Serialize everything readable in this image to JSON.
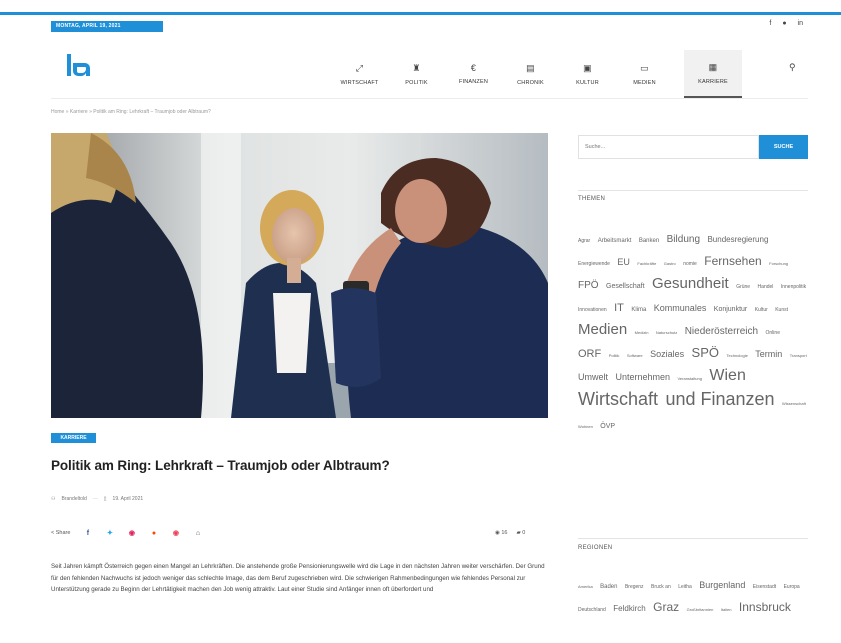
{
  "topbar": {
    "date": "MONTAG, APRIL 19, 2021",
    "social": [
      "f",
      "●",
      "in"
    ]
  },
  "logo": {
    "text": "la",
    "color": "#1f8fd8"
  },
  "nav": {
    "items": [
      {
        "label": "WIRTSCHAFT",
        "icon": "chart-icon",
        "glyph": "⤢"
      },
      {
        "label": "POLITIK",
        "icon": "building-icon",
        "glyph": "♜"
      },
      {
        "label": "FINANZEN",
        "icon": "euro-icon",
        "glyph": "€"
      },
      {
        "label": "CHRONIK",
        "icon": "newspaper-icon",
        "glyph": "▤"
      },
      {
        "label": "KULTUR",
        "icon": "picture-icon",
        "glyph": "▣"
      },
      {
        "label": "MEDIEN",
        "icon": "monitor-icon",
        "glyph": "▭"
      },
      {
        "label": "KARRIERE",
        "icon": "clipboard-icon",
        "glyph": "▦",
        "active": true
      }
    ],
    "search_glyph": "⚲"
  },
  "breadcrumb": "Home  »  Karriere  »  Politik am Ring: Lehrkraft – Traumjob oder Albtraum?",
  "article": {
    "category": "KARRIERE",
    "title": "Politik am Ring: Lehrkraft – Traumjob oder Albtraum?",
    "author": "Brandeltold",
    "date": "19. April 2021",
    "share_label": "Share",
    "share_icons": [
      {
        "name": "facebook-icon",
        "glyph": "f",
        "color": "#3b5998"
      },
      {
        "name": "twitter-icon",
        "glyph": "✦",
        "color": "#1da1f2"
      },
      {
        "name": "pinterest-icon",
        "glyph": "◉",
        "color": "#e0245e"
      },
      {
        "name": "reddit-icon",
        "glyph": "●",
        "color": "#ff4500"
      },
      {
        "name": "pocket-icon",
        "glyph": "◉",
        "color": "#ef4056"
      },
      {
        "name": "print-icon",
        "glyph": "⌂",
        "color": "#555555"
      }
    ],
    "views": "16",
    "comments": "0",
    "body": "Seit Jahren kämpft Österreich gegen einen Mangel an Lehrkräften. Die anstehende große Pensionierungswelle wird die Lage in den nächsten Jahren weiter verschärfen. Der Grund für den fehlenden Nachwuchs ist jedoch weniger das schlechte Image, das dem Beruf zugeschrieben wird. Die schwierigen Rahmenbedingungen wie fehlendes Personal zur Unterstützung gerade zu Beginn der Lehrtätigkeit machen den Job wenig attraktiv. Laut einer Studie sind Anfänger innen oft überfordert und"
  },
  "sidebar": {
    "search_placeholder": "Suche...",
    "search_button": "SUCHE",
    "themes_title": "THEMEN",
    "themes": [
      {
        "t": "Agrar",
        "s": 5
      },
      {
        "t": "Arbeitsmarkt",
        "s": 6
      },
      {
        "t": "Banken",
        "s": 6
      },
      {
        "t": "Bildung",
        "s": 10
      },
      {
        "t": "Bundesregierung",
        "s": 8
      },
      {
        "t": "Energiewende",
        "s": 5
      },
      {
        "t": "EU",
        "s": 9
      },
      {
        "t": "Fachkräfte",
        "s": 4
      },
      {
        "t": "Gastro",
        "s": 4
      },
      {
        "t": "nomie",
        "s": 5
      },
      {
        "t": "Fernsehen",
        "s": 12
      },
      {
        "t": "Forschung",
        "s": 4
      },
      {
        "t": "FPÖ",
        "s": 10
      },
      {
        "t": "Gesellschaft",
        "s": 7
      },
      {
        "t": "Gesundheit",
        "s": 15
      },
      {
        "t": "Grüne",
        "s": 5
      },
      {
        "t": "Handel",
        "s": 5
      },
      {
        "t": "Innenpolitik",
        "s": 5
      },
      {
        "t": "Innovationen",
        "s": 5
      },
      {
        "t": "IT",
        "s": 11
      },
      {
        "t": "Klima",
        "s": 6
      },
      {
        "t": "Kommunales",
        "s": 9
      },
      {
        "t": "Konjunktur",
        "s": 7
      },
      {
        "t": "Kultur",
        "s": 5
      },
      {
        "t": "Kunst",
        "s": 5
      },
      {
        "t": "Medien",
        "s": 15
      },
      {
        "t": "Medizin",
        "s": 4
      },
      {
        "t": "Naturschutz",
        "s": 4
      },
      {
        "t": "Niederösterreich",
        "s": 10
      },
      {
        "t": "Online",
        "s": 5
      },
      {
        "t": "ORF",
        "s": 11
      },
      {
        "t": "Politik",
        "s": 4
      },
      {
        "t": "Software",
        "s": 4
      },
      {
        "t": "Soziales",
        "s": 9
      },
      {
        "t": "SPÖ",
        "s": 13
      },
      {
        "t": "Technologie",
        "s": 4
      },
      {
        "t": "Termin",
        "s": 9
      },
      {
        "t": "Transport",
        "s": 4
      },
      {
        "t": "Umwelt",
        "s": 9
      },
      {
        "t": "Unternehmen",
        "s": 9
      },
      {
        "t": "Veranstaltung",
        "s": 4
      },
      {
        "t": "Wien",
        "s": 16
      },
      {
        "t": "Wirtschaft",
        "s": 18
      },
      {
        "t": "und Finanzen",
        "s": 18
      },
      {
        "t": "Wissenschaft",
        "s": 4
      },
      {
        "t": "Wohnen",
        "s": 4
      },
      {
        "t": "ÖVP",
        "s": 7
      }
    ],
    "regions_title": "REGIONEN",
    "regions": [
      {
        "t": "Amerika",
        "s": 4
      },
      {
        "t": "Baden",
        "s": 6
      },
      {
        "t": "Bregenz",
        "s": 5
      },
      {
        "t": "Bruck an",
        "s": 5
      },
      {
        "t": "Leitha",
        "s": 5
      },
      {
        "t": "Burgenland",
        "s": 9
      },
      {
        "t": "Eisenstadt",
        "s": 5
      },
      {
        "t": "Europa",
        "s": 5
      },
      {
        "t": "Deutschland",
        "s": 5
      },
      {
        "t": "Feldkirch",
        "s": 8
      },
      {
        "t": "Graz",
        "s": 12
      },
      {
        "t": "Großbritannien",
        "s": 4
      },
      {
        "t": "Italien",
        "s": 4
      },
      {
        "t": "Innsbruck",
        "s": 12
      }
    ]
  }
}
